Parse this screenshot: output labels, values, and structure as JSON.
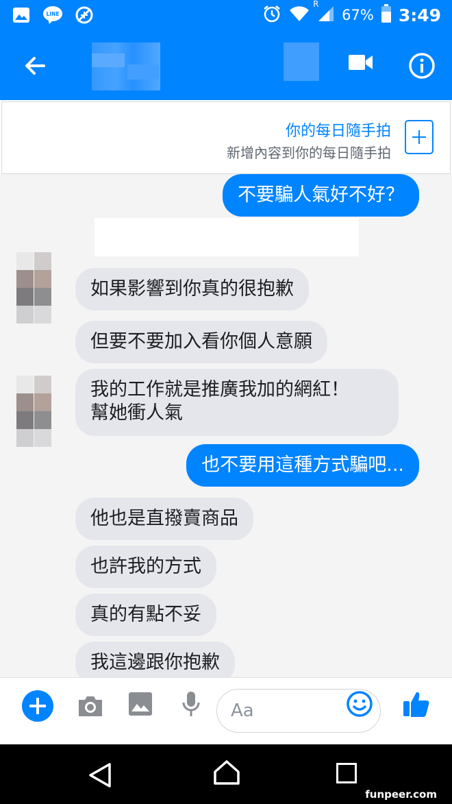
{
  "status_bar": {
    "line_label": "LINE",
    "roaming": "R",
    "battery": "67%",
    "time": "3:49"
  },
  "header": {
    "contact_name": ""
  },
  "banner": {
    "title": "你的每日隨手拍",
    "subtitle": "新增內容到你的每日隨手拍"
  },
  "messages": [
    {
      "side": "out",
      "text": "不要騙人氣好不好？"
    },
    {
      "side": "in",
      "text": "如果影響到你真的很抱歉"
    },
    {
      "side": "in",
      "text": "但要不要加入看你個人意願"
    },
    {
      "side": "in",
      "text": "我的工作就是推廣我加的網紅！"
    },
    {
      "side": "in",
      "text": "幫她衝人氣"
    },
    {
      "side": "out",
      "text": "也不要用這種方式騙吧..."
    },
    {
      "side": "in",
      "text": "他也是直撥賣商品"
    },
    {
      "side": "in",
      "text": "也許我的方式"
    },
    {
      "side": "in",
      "text": "真的有點不妥"
    },
    {
      "side": "in",
      "text": "我這邊跟你抱歉"
    }
  ],
  "composer": {
    "placeholder": "Aa"
  },
  "watermark": "funpeer.com",
  "colors": {
    "accent": "#0084ff",
    "incoming_bubble": "#e4e6eb",
    "chat_background": "#f4f4f4"
  },
  "icons": [
    "image-icon",
    "line-icon",
    "no-signal-icon",
    "alarm-icon",
    "wifi-icon",
    "cell-signal-icon",
    "battery-icon",
    "back-arrow-icon",
    "video-call-icon",
    "info-icon",
    "add-box-icon",
    "plus-icon",
    "camera-icon",
    "gallery-icon",
    "mic-icon",
    "emoji-icon",
    "thumbs-up-icon",
    "nav-back-icon",
    "nav-home-icon",
    "nav-recents-icon"
  ]
}
